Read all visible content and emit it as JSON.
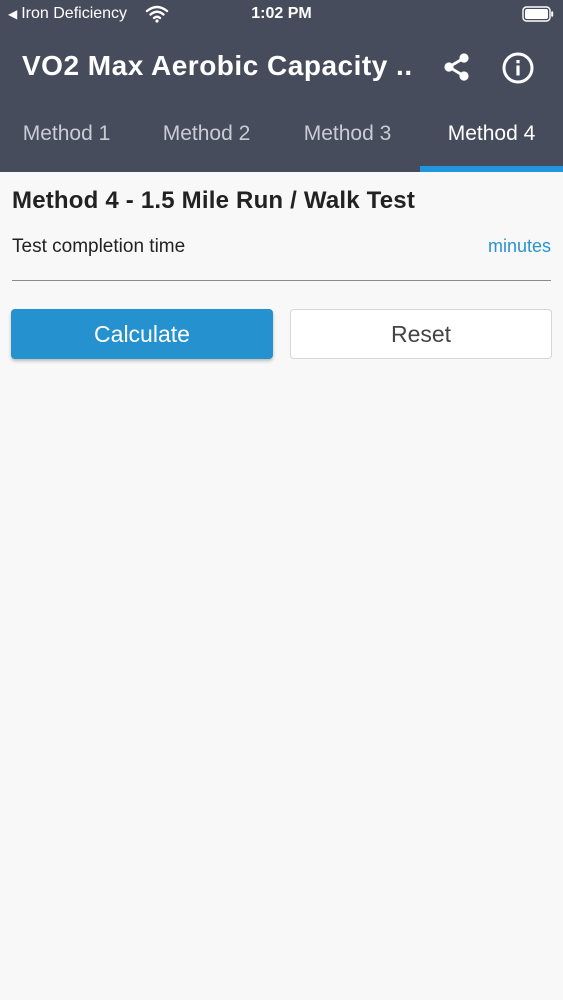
{
  "status_bar": {
    "back_app": "Iron Deficiency",
    "time": "1:02 PM",
    "wifi_icon": "wifi-icon",
    "battery_icon": "battery-icon"
  },
  "header": {
    "title": "VO2 Max Aerobic Capacity ...",
    "share_icon": "share-icon",
    "info_icon": "info-icon",
    "background_color": "#474c5c"
  },
  "tabs": [
    {
      "label": "Method 1",
      "active": false
    },
    {
      "label": "Method 2",
      "active": false
    },
    {
      "label": "Method 3",
      "active": false
    },
    {
      "label": "Method 4",
      "active": true
    }
  ],
  "accent_color": "#2196dc",
  "main": {
    "method_title": "Method 4 - 1.5 Mile Run / Walk Test",
    "field": {
      "label": "Test completion time",
      "unit": "minutes",
      "value": ""
    },
    "calculate_label": "Calculate",
    "reset_label": "Reset"
  }
}
